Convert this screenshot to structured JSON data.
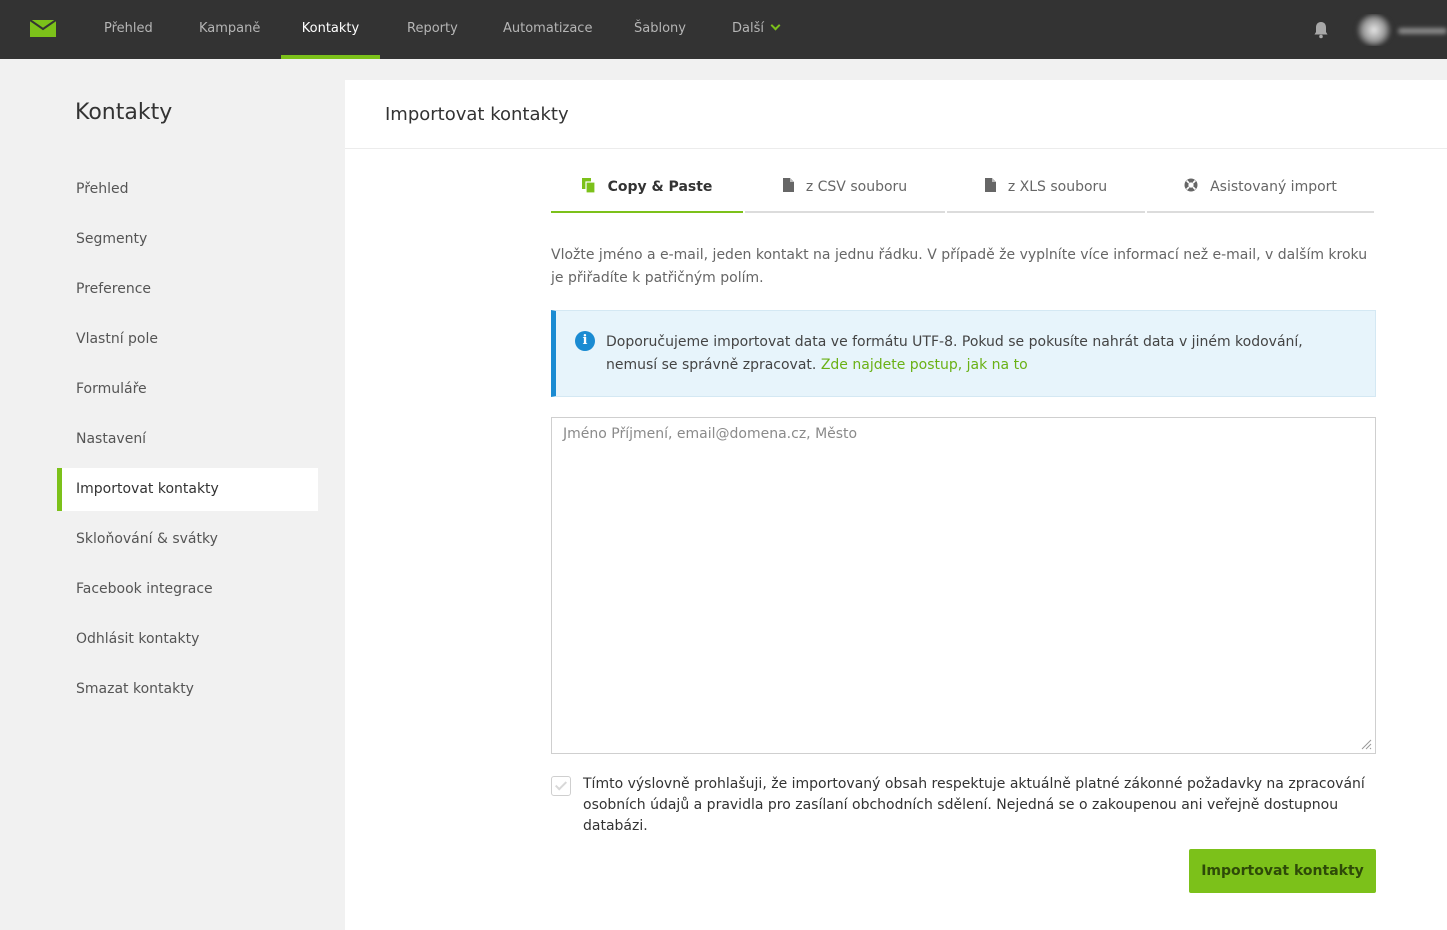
{
  "nav": {
    "items": [
      {
        "label": "Přehled"
      },
      {
        "label": "Kampaně"
      },
      {
        "label": "Kontakty"
      },
      {
        "label": "Reporty"
      },
      {
        "label": "Automatizace"
      },
      {
        "label": "Šablony"
      },
      {
        "label": "Další"
      }
    ],
    "active": "Kontakty",
    "accent_color": "#7cc11a",
    "bar_color": "#333333"
  },
  "sidebar": {
    "title": "Kontakty",
    "items": [
      {
        "label": "Přehled"
      },
      {
        "label": "Segmenty"
      },
      {
        "label": "Preference"
      },
      {
        "label": "Vlastní pole"
      },
      {
        "label": "Formuláře"
      },
      {
        "label": "Nastavení"
      },
      {
        "label": "Importovat kontakty"
      },
      {
        "label": "Skloňování & svátky"
      },
      {
        "label": "Facebook integrace"
      },
      {
        "label": "Odhlásit kontakty"
      },
      {
        "label": "Smazat kontakty"
      }
    ],
    "active": "Importovat kontakty"
  },
  "main": {
    "title": "Importovat kontakty",
    "tabs": [
      {
        "label": "Copy & Paste",
        "icon": "copy-icon"
      },
      {
        "label": "z CSV souboru",
        "icon": "file-icon"
      },
      {
        "label": "z XLS souboru",
        "icon": "file-icon"
      },
      {
        "label": "Asistovaný import",
        "icon": "lifebuoy-icon"
      }
    ],
    "active_tab": "Copy & Paste",
    "intro": "Vložte jméno a e-mail, jeden kontakt na jednu řádku. V případě že vyplníte více informací než e-mail, v dalším kroku je přiřadíte k patřičným polím.",
    "info": {
      "text": "Doporučujeme importovat data ve formátu UTF-8. Pokud se pokusíte nahrát data v jiném kodování, nemusí se správně zpracovat.",
      "link": "Zde najdete postup, jak na to",
      "icon": "info-icon",
      "color": "#1a8bd2"
    },
    "textarea": {
      "placeholder": "Jméno Příjmení, email@domena.cz, Město",
      "value": ""
    },
    "consent": {
      "checked": false,
      "text": "Tímto výslovně prohlašuji, že importovaný obsah respektuje aktuálně platné zákonné požadavky na zpracování osobních údajů a pravidla pro zasílaní obchodních sdělení. Nejedná se o zakoupenou ani veřejně dostupnou databázi."
    },
    "submit_label": "Importovat kontakty"
  }
}
